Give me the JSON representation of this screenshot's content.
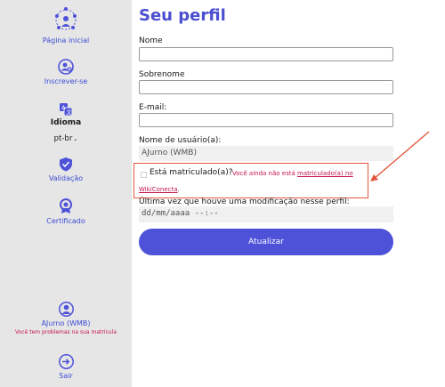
{
  "sidebar": {
    "home_label": "Página inicial",
    "enroll_label": "Inscrever-se",
    "language_label": "Idioma",
    "language_value": "pt-br",
    "validation_label": "Validação",
    "certificate_label": "Certificado",
    "user_name": "AJurno (WMB)",
    "user_warning": "Você tem problemas na sua matrícula",
    "logout_label": "Sair"
  },
  "form": {
    "title": "Seu perfil",
    "first_name_label": "Nome",
    "first_name_value": "",
    "last_name_label": "Sobrenome",
    "last_name_value": "",
    "email_label": "E-mail:",
    "email_value": "",
    "username_label": "Nome de usuário(a):",
    "username_value": "AJurno (WMB)",
    "enrolled_label": "Está matriculado(a)?",
    "enrolled_checked": false,
    "enrolled_warning_prefix": "Você ainda não está",
    "enrolled_warning_link": "matriculado(a) no",
    "enrolled_warning_link2": "WikiConecta",
    "enrolled_warning_suffix": ".",
    "last_modified_label": "Última vez que houve uma modificação nesse perfil:",
    "last_modified_placeholder": "dd/mm/aaaa --:--",
    "submit_label": "Atualizar"
  },
  "colors": {
    "accent": "#4d52d9",
    "title": "#4b4fd0",
    "warning": "#c4144a",
    "annotation": "#e2573b",
    "sidebar_bg": "#e6e6e6"
  }
}
